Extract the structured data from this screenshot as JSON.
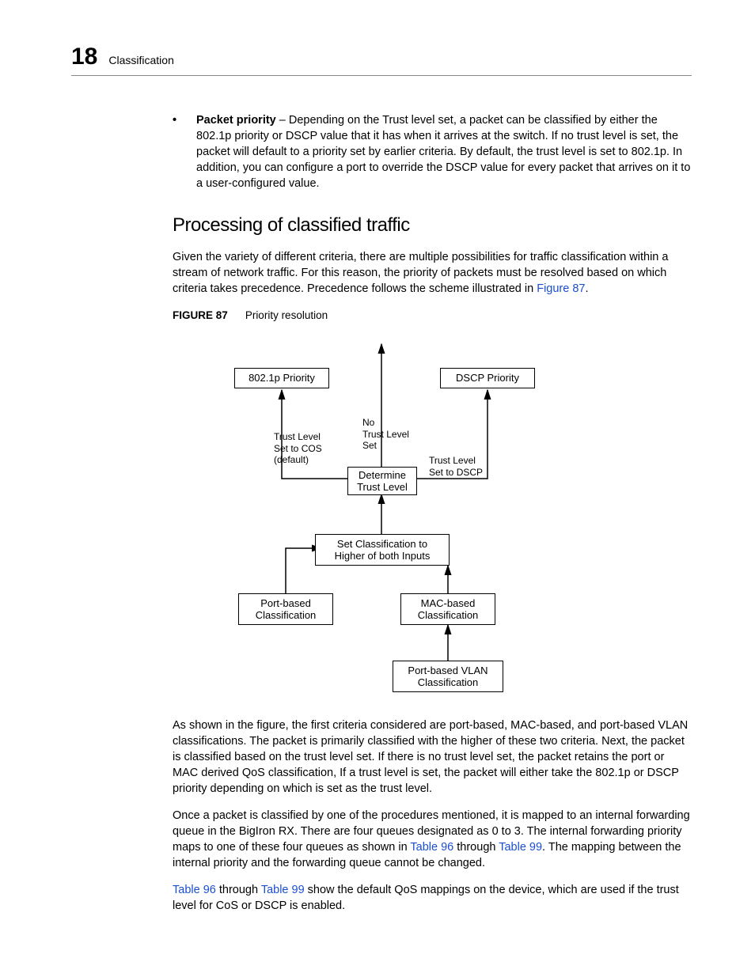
{
  "header": {
    "chapter_number": "18",
    "section_title": "Classification"
  },
  "bullet": {
    "term": "Packet priority",
    "text": " – Depending on the Trust level set, a packet can be classified by either the 802.1p priority or DSCP value that it has when it arrives at the switch. If no trust level is set, the packet will default to a priority set by earlier criteria. By default, the trust level is set to 802.1p. In addition, you can configure a port to override the DSCP value for every packet that arrives on it to a user-configured value."
  },
  "heading": "Processing of classified traffic",
  "intro_a": "Given the variety of different criteria, there are multiple possibilities for traffic classification within a stream of network traffic. For this reason, the priority of packets must be resolved based on which criteria takes precedence. Precedence follows the scheme illustrated in ",
  "intro_link": "Figure 87",
  "intro_b": ".",
  "figure": {
    "label": "FIGURE 87",
    "title": "Priority resolution"
  },
  "diagram": {
    "box_8021p": "802.1p Priority",
    "box_dscp": "DSCP Priority",
    "box_determine": "Determine\nTrust Level",
    "box_setclass": "Set Classification to\nHigher of both Inputs",
    "box_port": "Port-based\nClassification",
    "box_mac": "MAC-based\nClassification",
    "box_vlan": "Port-based VLAN\nClassification",
    "lbl_cos": "Trust Level\nSet to COS\n(default)",
    "lbl_none": "No\nTrust Level\nSet",
    "lbl_dscp": "Trust Level\nSet to DSCP"
  },
  "para2_a": "As shown in the figure, the first criteria considered are port-based, MAC-based, and port-based VLAN  classifications. The packet is primarily classified with the higher of these two criteria. Next, the packet is classified based on the trust level set. If there is no trust level set, the packet retains the port or MAC derived QoS classification, If a trust level is set, the packet will either take the 802.1p or DSCP priority depending on which is set as the trust level.",
  "para3_a": "Once a packet is classified by one of the procedures mentioned, it is mapped to an internal forwarding queue in the BigIron RX. There are four queues designated as 0 to 3. The internal forwarding priority maps to one of these four queues as shown in ",
  "para3_link1": "Table 96",
  "para3_mid": " through ",
  "para3_link2": "Table 99",
  "para3_b": ". The mapping between the internal priority and the forwarding queue cannot be changed.",
  "para4_link1": "Table 96",
  "para4_mid": " through ",
  "para4_link2": "Table 99",
  "para4_b": " show the default QoS mappings on the device, which are used if the trust level for CoS or DSCP is enabled."
}
